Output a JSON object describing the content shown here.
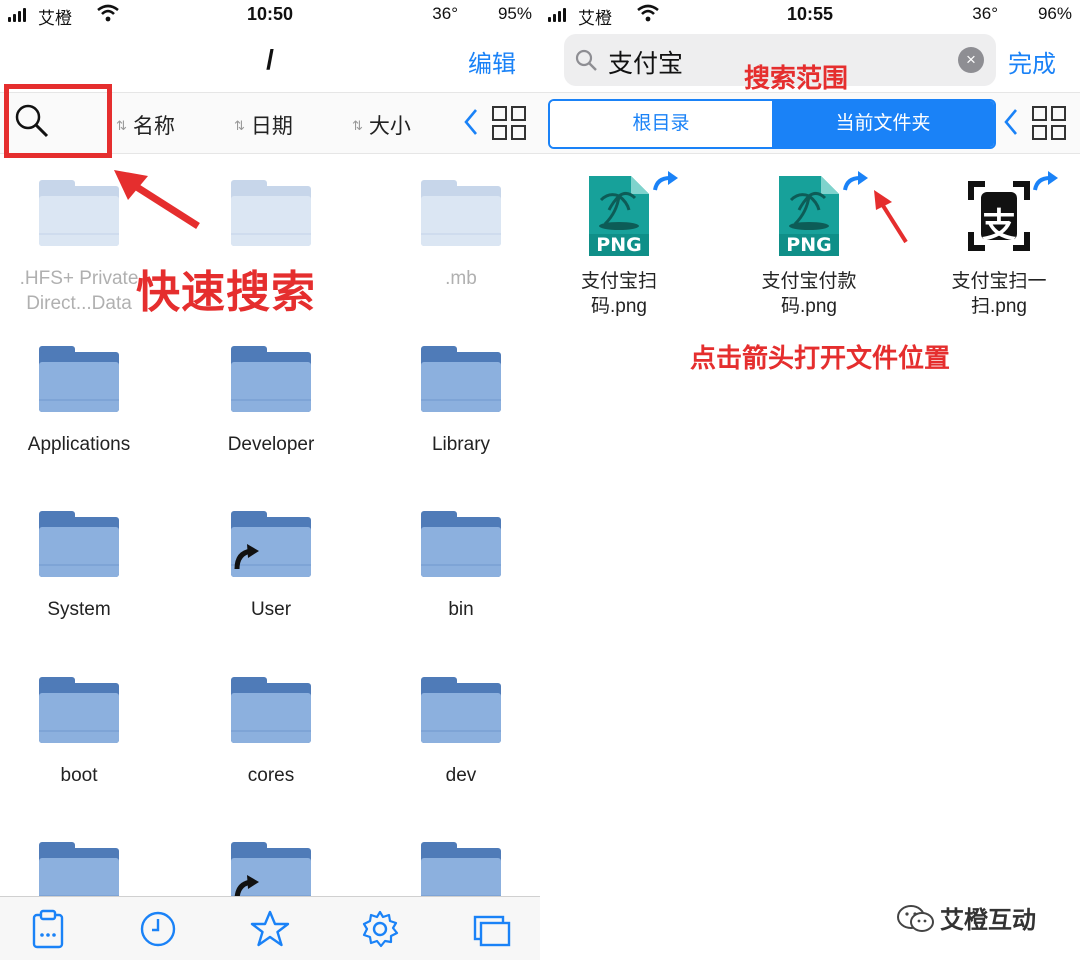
{
  "left": {
    "status": {
      "carrier": "艾橙",
      "time": "10:50",
      "temp": "36°",
      "battery": "95%"
    },
    "nav": {
      "title": "/",
      "edit": "编辑"
    },
    "sort": {
      "name": "名称",
      "date": "日期",
      "size": "大小"
    },
    "folders": [
      {
        "label": ".HFS+ Private\nDirect...Data",
        "dim": true
      },
      {
        "label": "",
        "dim": true
      },
      {
        "label": ".mb",
        "dim": true
      },
      {
        "label": "Applications"
      },
      {
        "label": "Developer"
      },
      {
        "label": "Library"
      },
      {
        "label": "System"
      },
      {
        "label": "User",
        "alias": true
      },
      {
        "label": "bin"
      },
      {
        "label": "boot"
      },
      {
        "label": "cores"
      },
      {
        "label": "dev"
      },
      {
        "label": ""
      },
      {
        "label": "",
        "alias": true
      },
      {
        "label": ""
      }
    ],
    "tabbar": [
      "clipboard-icon",
      "clock-icon",
      "star-icon",
      "gear-icon",
      "windows-icon",
      "clipboard-disabled-icon"
    ]
  },
  "right": {
    "status": {
      "carrier": "艾橙",
      "time": "10:55",
      "temp": "36°",
      "battery": "96%"
    },
    "search": {
      "query": "支付宝",
      "clear": "×",
      "done": "完成"
    },
    "scope": {
      "root": "根目录",
      "current": "当前文件夹",
      "active": "current"
    },
    "files": [
      {
        "label": "支付宝扫\n码.png",
        "kind": "png",
        "badge": "PNG"
      },
      {
        "label": "支付宝付款\n码.png",
        "kind": "png",
        "badge": "PNG"
      },
      {
        "label": "支付宝扫一\n扫.png",
        "kind": "alipay",
        "badge": "支"
      }
    ],
    "watermark": "艾橙互动"
  },
  "annotations": {
    "quick_search": "快速搜索",
    "search_scope": "搜索范围",
    "open_location": "点击箭头打开文件位置"
  },
  "colors": {
    "accent": "#1a82f7",
    "annotation": "#e52e2e",
    "folder": "#8cb0de",
    "folder_dark": "#4f7bb8",
    "png_teal": "#17a19a"
  }
}
